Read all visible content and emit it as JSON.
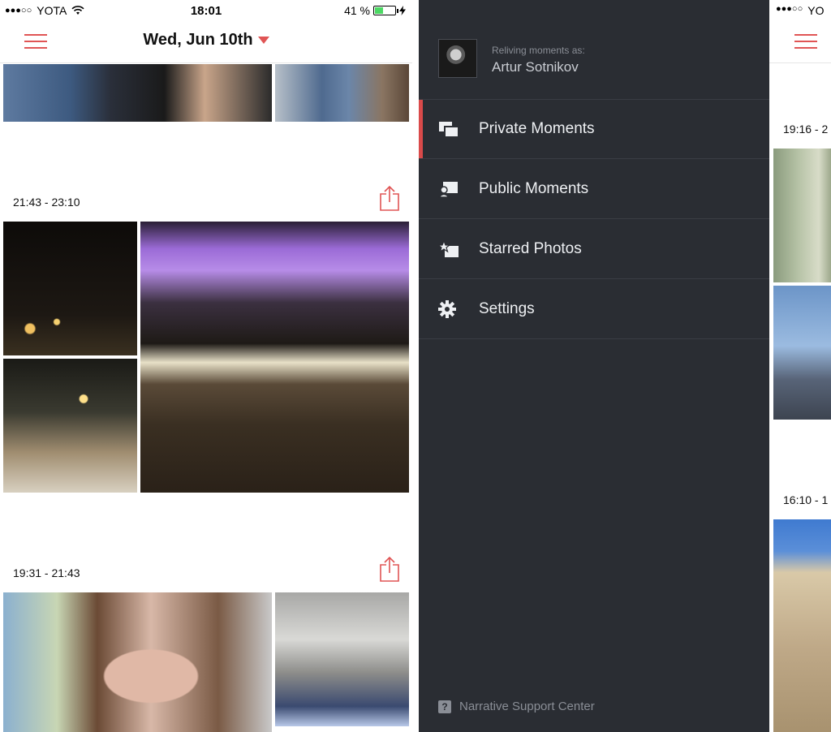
{
  "status_bar": {
    "signal": "●●●○○",
    "carrier": "YOTA",
    "time": "18:01",
    "battery_percent": "41 %",
    "battery_level": 0.41
  },
  "header": {
    "title": "Wed, Jun 10th"
  },
  "sections": [
    {
      "time_range": "21:43 - 23:10"
    },
    {
      "time_range": "19:31 - 21:43"
    }
  ],
  "drawer": {
    "relive_label": "Reliving moments as:",
    "user_name": "Artur Sotnikov",
    "menu": [
      {
        "label": "Private Moments",
        "icon": "stacked-photos-icon",
        "active": true
      },
      {
        "label": "Public Moments",
        "icon": "public-photo-icon",
        "active": false
      },
      {
        "label": "Starred Photos",
        "icon": "star-photo-icon",
        "active": false
      },
      {
        "label": "Settings",
        "icon": "gear-icon",
        "active": false
      }
    ],
    "support": {
      "label": "Narrative Support Center",
      "icon": "help-icon",
      "glyph": "?"
    }
  },
  "right_peek": {
    "status_signal": "●●●○○",
    "status_carrier_partial": "YO",
    "section_times_partial": [
      "19:16 - 2",
      "16:10 - 1"
    ]
  },
  "colors": {
    "accent": "#e05555",
    "drawer_bg": "#2a2d33",
    "active_bar": "#d94a4a"
  }
}
